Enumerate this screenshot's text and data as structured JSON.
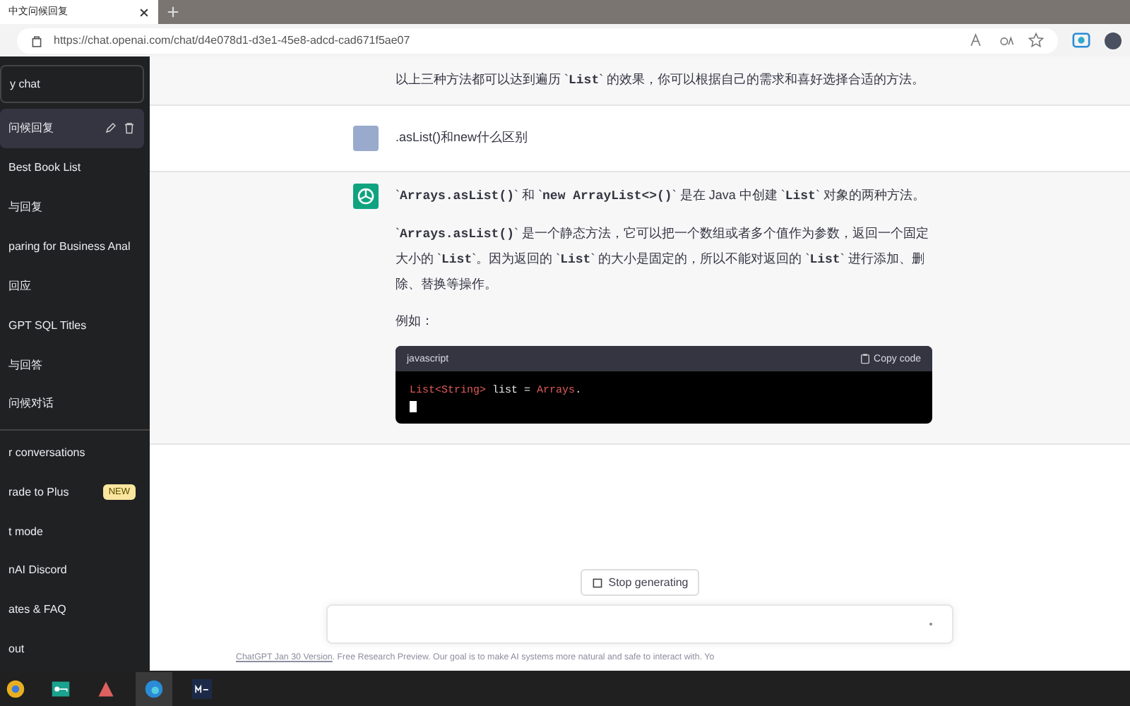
{
  "browser": {
    "tab": {
      "title": "中文问候回复",
      "selected": true
    },
    "url": "https://chat.openai.com/chat/d4e078d1-d3e1-45e8-adcd-cad671f5ae07"
  },
  "sidebar": {
    "new_chat": "y chat",
    "history": [
      {
        "title": "问候回复",
        "selected": true
      },
      {
        "title": "Best Book List",
        "selected": false
      },
      {
        "title": "与回复",
        "selected": false
      },
      {
        "title": "paring for Business Anal",
        "selected": false
      },
      {
        "title": "回应",
        "selected": false
      },
      {
        "title": "GPT SQL Titles",
        "selected": false
      },
      {
        "title": "与回答",
        "selected": false
      },
      {
        "title": "问候对话",
        "selected": false
      }
    ],
    "menu": [
      {
        "label": "r conversations"
      },
      {
        "label": "rade to Plus",
        "badge": "NEW"
      },
      {
        "label": "t mode"
      },
      {
        "label": "nAI Discord"
      },
      {
        "label": "ates & FAQ"
      },
      {
        "label": "out"
      }
    ]
  },
  "conversation": [
    {
      "kind": "assistant",
      "paragraphs": [
        "以上三种方法都可以达到遍历 `**List**` 的效果，你可以根据自己的需求和喜好选择合适的方法。"
      ]
    },
    {
      "kind": "user",
      "paragraphs": [
        ".asList()和new什么区别"
      ]
    },
    {
      "kind": "assistant",
      "paragraphs": [
        "`**Arrays.asList()**` 和 `**new ArrayList<>()**` 是在 Java 中创建 `**List**` 对象的两种方法。",
        "`**Arrays.asList()**` 是一个静态方法，它可以把一个数组或者多个值作为参数，返回一个固定大小的 `**List**`。因为返回的 `**List**` 的大小是固定的，所以不能对返回的 `**List**` 进行添加、删除、替换等操作。",
        "例如："
      ],
      "code": {
        "language": "javascript",
        "copy_label": "Copy code",
        "tokens": [
          {
            "kind": "type",
            "text": "List"
          },
          {
            "kind": "type",
            "text": "<String>"
          },
          {
            "kind": "plain",
            "text": " list = "
          },
          {
            "kind": "type",
            "text": "Arrays"
          },
          {
            "kind": "plain",
            "text": "."
          }
        ]
      }
    }
  ],
  "stop_button": "Stop generating",
  "footer": {
    "link": "ChatGPT Jan 30 Version",
    "text": ". Free Research Preview. Our goal is to make AI systems more natural and safe to interact with. Yo"
  }
}
